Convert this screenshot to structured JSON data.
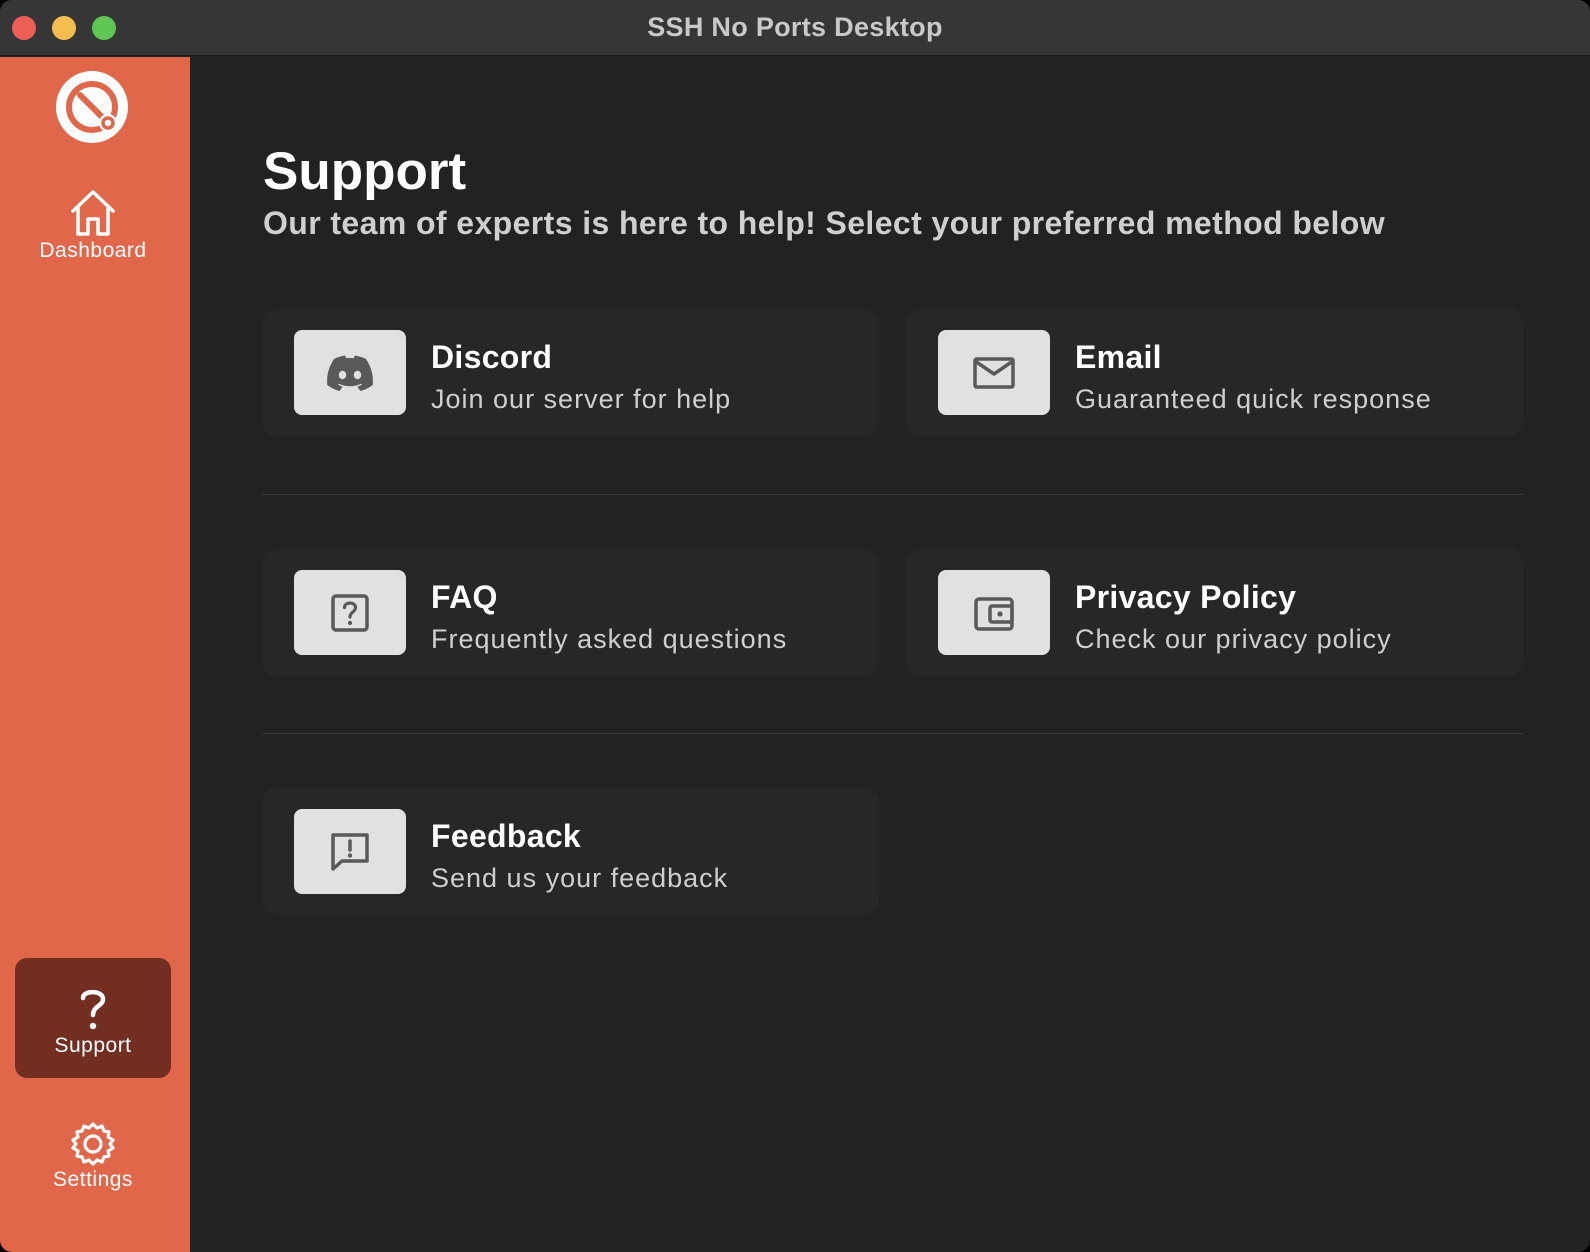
{
  "window": {
    "title": "SSH No Ports Desktop"
  },
  "sidebar": {
    "items": [
      {
        "label": "Dashboard",
        "icon": "home-icon"
      },
      {
        "label": "Support",
        "icon": "question-mark-icon",
        "active": true
      },
      {
        "label": "Settings",
        "icon": "gear-icon"
      }
    ]
  },
  "page": {
    "title": "Support",
    "subtitle": "Our team of experts is here to help! Select your preferred method below"
  },
  "cards": [
    {
      "title": "Discord",
      "description": "Join our server for help",
      "icon": "discord-icon"
    },
    {
      "title": "Email",
      "description": "Guaranteed quick response",
      "icon": "envelope-icon"
    },
    {
      "title": "FAQ",
      "description": "Frequently asked questions",
      "icon": "question-box-icon"
    },
    {
      "title": "Privacy Policy",
      "description": "Check our privacy policy",
      "icon": "wallet-icon"
    },
    {
      "title": "Feedback",
      "description": "Send us your feedback",
      "icon": "feedback-icon"
    }
  ],
  "colors": {
    "sidebar": "#e1674b",
    "sidebar_active": "#732e22",
    "background": "#222222",
    "card": "#272727",
    "icon_box": "#e1e1e1"
  }
}
